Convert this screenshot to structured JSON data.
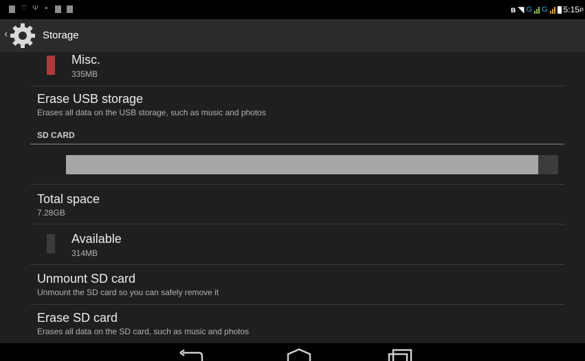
{
  "status_bar": {
    "time": "5:15",
    "time_suffix": "P",
    "network_label": "G",
    "network_label_2": "G",
    "left_icons": [
      "gallery-notification-icon",
      "wifi-notification-icon",
      "usb-icon",
      "lock-icon",
      "gallery-notification-icon",
      "app-notification-icon"
    ],
    "right_icons": [
      "bluetooth-icon",
      "wifi-icon",
      "signal-icon",
      "signal-icon",
      "battery-icon"
    ]
  },
  "action_bar": {
    "title": "Storage",
    "icon": "settings-gear-icon",
    "up_icon": "back-caret-icon"
  },
  "storage": {
    "misc": {
      "label": "Misc.",
      "value": "335MB",
      "color": "#b23a3a"
    },
    "erase_usb": {
      "title": "Erase USB storage",
      "summary": "Erases all data on the USB storage, such as music and photos"
    },
    "sd_card": {
      "header": "SD CARD",
      "used_fraction": 0.96,
      "used_color": "#a7a7a7",
      "free_color": "#3b3c3c",
      "total_label": "Total space",
      "total_value": "7.28GB",
      "available_label": "Available",
      "available_value": "314MB",
      "available_color": "#3b3c3c"
    },
    "unmount": {
      "title": "Unmount SD card",
      "summary": "Unmount the SD card so you can safely remove it"
    },
    "erase_sd": {
      "title": "Erase SD card",
      "summary": "Erases all data on the SD card, such as music and photos"
    }
  },
  "nav_bar": {
    "buttons": [
      "back-icon",
      "home-icon",
      "recent-apps-icon"
    ]
  }
}
